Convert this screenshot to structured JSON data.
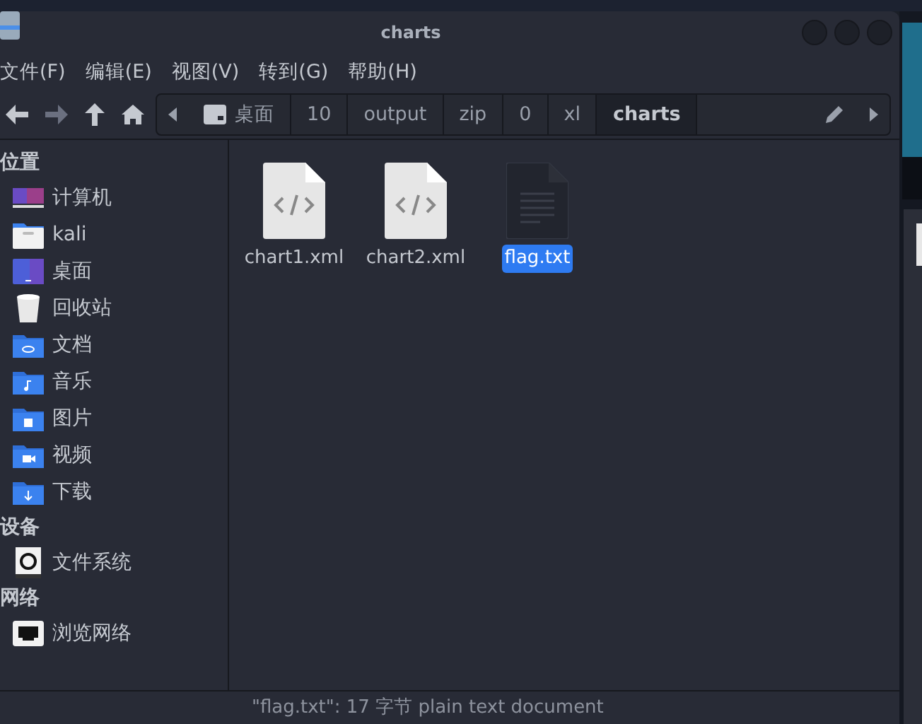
{
  "window": {
    "title": "charts"
  },
  "menu": [
    "文件(F)",
    "编辑(E)",
    "视图(V)",
    "转到(G)",
    "帮助(H)"
  ],
  "path": [
    {
      "label": "桌面",
      "kind": "desktop",
      "selected": false
    },
    {
      "label": "10",
      "kind": "folder",
      "selected": false
    },
    {
      "label": "output",
      "kind": "folder",
      "selected": false
    },
    {
      "label": "zip",
      "kind": "folder",
      "selected": false
    },
    {
      "label": "0",
      "kind": "folder",
      "selected": false
    },
    {
      "label": "xl",
      "kind": "folder",
      "selected": false
    },
    {
      "label": "charts",
      "kind": "folder",
      "selected": true
    }
  ],
  "sidebar": [
    {
      "heading": "位置",
      "items": [
        {
          "label": "计算机",
          "kind": "computer"
        },
        {
          "label": "kali",
          "kind": "home"
        },
        {
          "label": "桌面",
          "kind": "desktop"
        },
        {
          "label": "回收站",
          "kind": "trash"
        },
        {
          "label": "文档",
          "kind": "documents"
        },
        {
          "label": "音乐",
          "kind": "music"
        },
        {
          "label": "图片",
          "kind": "pictures"
        },
        {
          "label": "视频",
          "kind": "videos"
        },
        {
          "label": "下载",
          "kind": "downloads"
        }
      ]
    },
    {
      "heading": "设备",
      "items": [
        {
          "label": "文件系统",
          "kind": "drive"
        }
      ]
    },
    {
      "heading": "网络",
      "items": [
        {
          "label": "浏览网络",
          "kind": "network"
        }
      ]
    }
  ],
  "files": [
    {
      "name": "chart1.xml",
      "kind": "code",
      "selected": false
    },
    {
      "name": "chart2.xml",
      "kind": "code",
      "selected": false
    },
    {
      "name": "flag.txt",
      "kind": "text",
      "selected": true
    }
  ],
  "status_bar": "\"flag.txt\": 17 字节 plain text document"
}
